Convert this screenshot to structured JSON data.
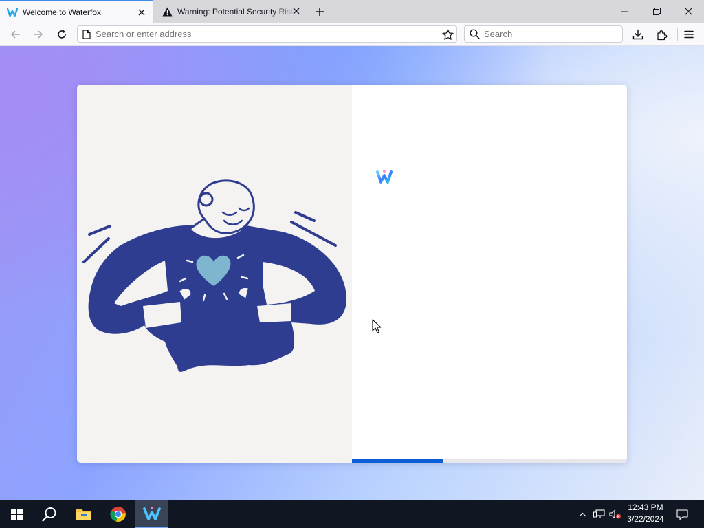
{
  "tabs": [
    {
      "title": "Welcome to Waterfox",
      "icon": "waterfox-icon",
      "active": true
    },
    {
      "title": "Warning: Potential Security Risk Ahead",
      "icon": "warning-icon",
      "active": false
    }
  ],
  "toolbar": {
    "url_placeholder": "Search or enter address",
    "search_placeholder": "Search"
  },
  "onboarding": {
    "progress_fraction": 0.33
  },
  "taskbar": {
    "apps": [
      "windows-start-icon",
      "search-icon",
      "file-explorer-icon",
      "chrome-icon",
      "waterfox-icon"
    ],
    "time": "12:43 PM",
    "date": "3/22/2024"
  },
  "colors": {
    "accent": "#0a5fd6",
    "illustration": "#2e3d8f",
    "heart": "#7fb6cf"
  }
}
